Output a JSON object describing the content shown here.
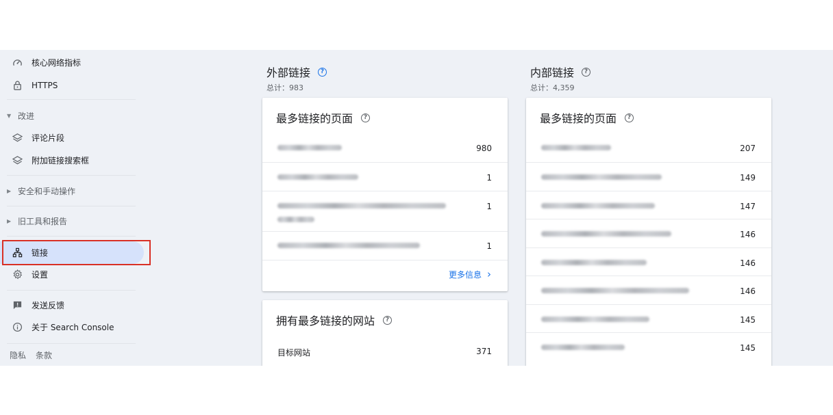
{
  "sidebar": {
    "items": [
      {
        "label": "核心网络指标",
        "icon": "speedometer-icon"
      },
      {
        "label": "HTTPS",
        "icon": "lock-icon"
      },
      {
        "label": "改进",
        "icon": "caret-down-icon"
      },
      {
        "label": "评论片段",
        "icon": "layers-icon"
      },
      {
        "label": "附加链接搜索框",
        "icon": "layers-icon"
      },
      {
        "label": "安全和手动操作",
        "icon": "caret-right-icon"
      },
      {
        "label": "旧工具和报告",
        "icon": "caret-right-icon"
      },
      {
        "label": "链接",
        "icon": "sitemap-icon"
      },
      {
        "label": "设置",
        "icon": "gear-icon"
      },
      {
        "label": "发送反馈",
        "icon": "feedback-icon"
      },
      {
        "label": "关于 Search Console",
        "icon": "info-icon"
      }
    ],
    "footer": {
      "privacy": "隐私",
      "terms": "条款"
    }
  },
  "external": {
    "title": "外部链接",
    "total": "总计：983",
    "top_pages": {
      "title": "最多链接的页面",
      "rows": [
        {
          "value": "980"
        },
        {
          "value": "1"
        },
        {
          "value": "1"
        },
        {
          "value": "1"
        }
      ],
      "more": "更多信息"
    },
    "top_sites": {
      "title": "拥有最多链接的网站",
      "rows": [
        {
          "label": "目标网站",
          "value": "371"
        }
      ]
    }
  },
  "internal": {
    "title": "内部链接",
    "total": "总计：4,359",
    "top_pages": {
      "title": "最多链接的页面",
      "rows": [
        {
          "value": "207"
        },
        {
          "value": "149"
        },
        {
          "value": "147"
        },
        {
          "value": "146"
        },
        {
          "value": "146"
        },
        {
          "value": "146"
        },
        {
          "value": "145"
        },
        {
          "value": "145"
        }
      ]
    }
  },
  "colors": {
    "accent": "#1a73e8",
    "active_nav": "#d6e2fb",
    "highlight": "#d93025",
    "background": "#eef1f6"
  }
}
